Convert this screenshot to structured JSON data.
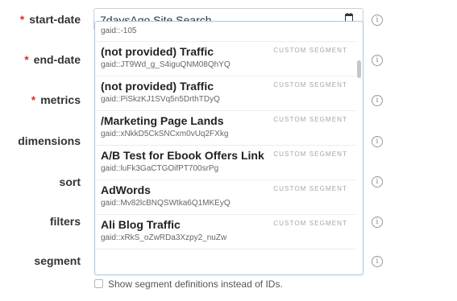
{
  "form": {
    "rows": [
      {
        "key": "start_date",
        "label": "start-date",
        "required": true
      },
      {
        "key": "end_date",
        "label": "end-date",
        "required": true
      },
      {
        "key": "metrics",
        "label": "metrics",
        "required": true
      },
      {
        "key": "dimensions",
        "label": "dimensions",
        "required": false
      },
      {
        "key": "sort",
        "label": "sort",
        "required": false
      },
      {
        "key": "filters",
        "label": "filters",
        "required": false
      },
      {
        "key": "segment",
        "label": "segment",
        "required": false
      }
    ],
    "required_marker": "*",
    "start_date_value": "7daysAgo Site Search",
    "info_glyph": "i"
  },
  "segment_dropdown": {
    "partial_first_gaid": "gaid::-105",
    "items": [
      {
        "title": "(not provided) Traffic",
        "gaid": "gaid::JT9Wd_g_S4iguQNM08QhYQ",
        "tag": "CUSTOM SEGMENT"
      },
      {
        "title": "(not provided) Traffic",
        "gaid": "gaid::PiSkzKJ1SVq5n5DrthTDyQ",
        "tag": "CUSTOM SEGMENT"
      },
      {
        "title": "/Marketing Page Lands",
        "gaid": "gaid::xNkkD5CkSNCxm0vUq2FXkg",
        "tag": "CUSTOM SEGMENT"
      },
      {
        "title": "A/B Test for Ebook Offers Link",
        "gaid": "gaid::luFk3GaCTGOifPT700srPg",
        "tag": "CUSTOM SEGMENT"
      },
      {
        "title": "AdWords",
        "gaid": "gaid::Mv82lcBNQSWtka6Q1MKEyQ",
        "tag": "CUSTOM SEGMENT"
      },
      {
        "title": "Ali Blog Traffic",
        "gaid": "gaid::xRkS_oZwRDa3Xzpy2_nuZw",
        "tag": "CUSTOM SEGMENT"
      }
    ]
  },
  "show_definitions": {
    "label": "Show segment definitions instead of IDs.",
    "checked": false
  },
  "icons": {
    "calendar": "calendar-icon",
    "info": "info-icon"
  },
  "colors": {
    "required": "#d9322f",
    "dropdown_border": "#a9c8e8",
    "tag_text": "#a5a5a5"
  }
}
